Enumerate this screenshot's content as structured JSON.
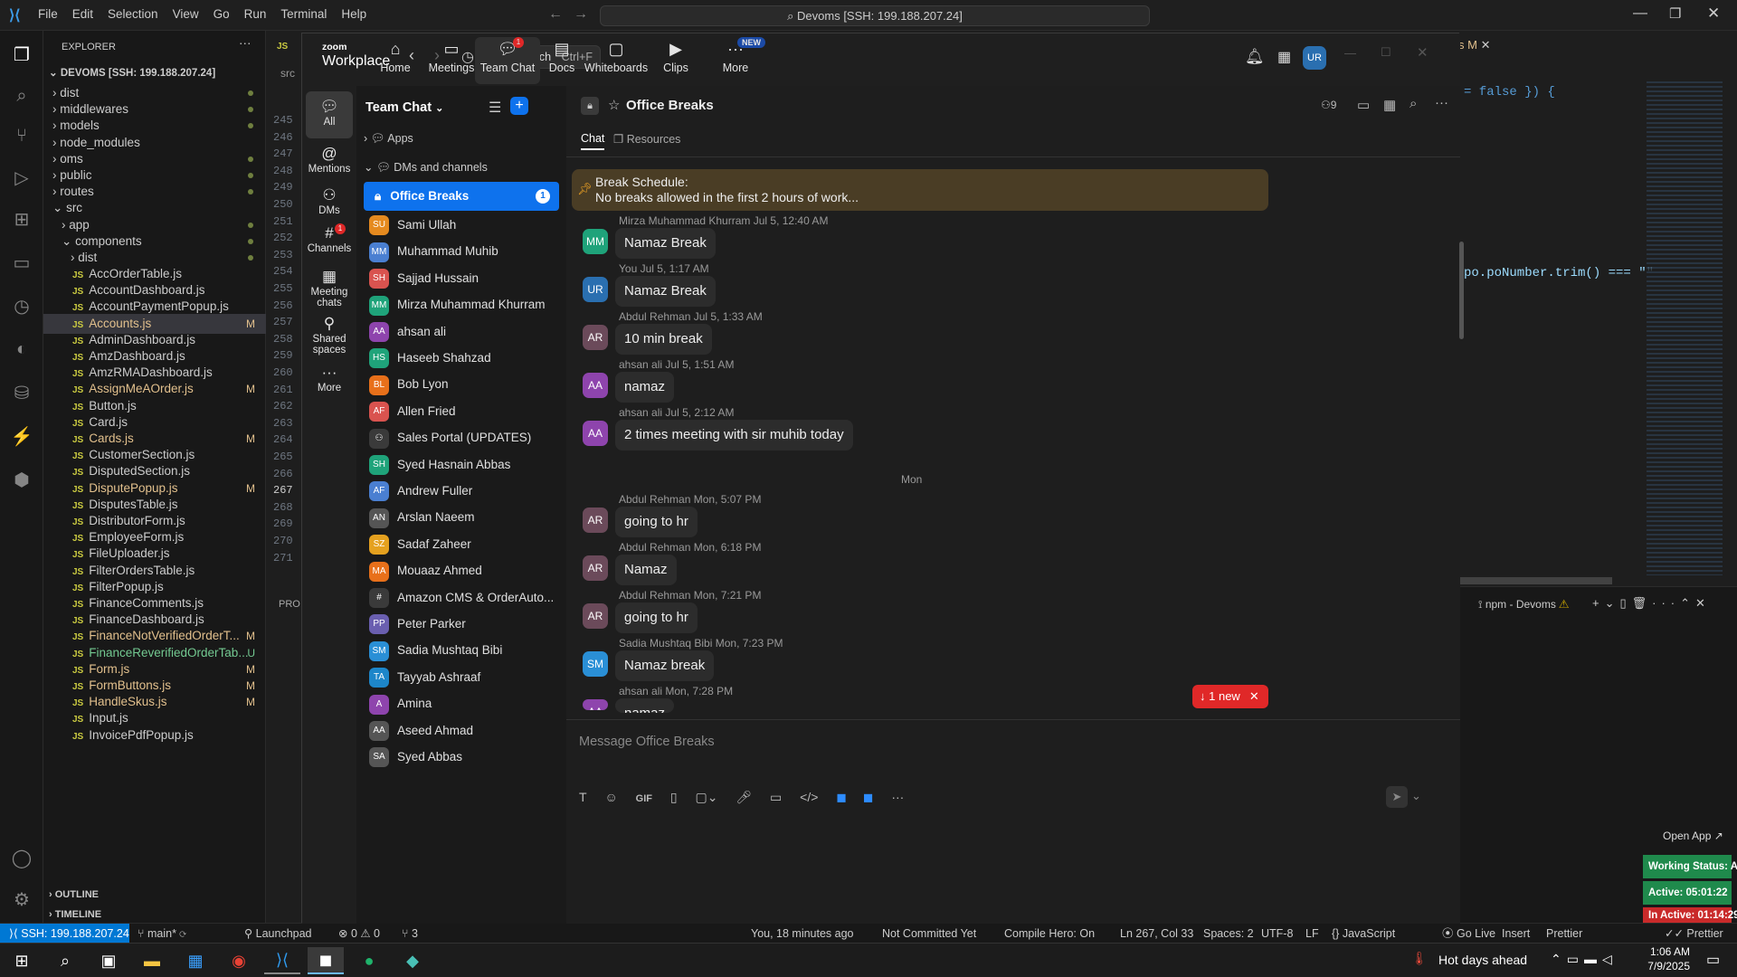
{
  "vscode": {
    "menu": [
      "File",
      "Edit",
      "Selection",
      "View",
      "Go",
      "Run",
      "Terminal",
      "Help"
    ],
    "command_center": "Devoms [SSH: 199.188.207.24]",
    "explorer_title": "EXPLORER",
    "root": "DEVOMS [SSH: 199.188.207.24]",
    "folders": [
      "dist",
      "middlewares",
      "models",
      "node_modules",
      "oms",
      "public",
      "routes",
      "src",
      "app",
      "components",
      "dist"
    ],
    "files": [
      {
        "name": "AccOrderTable.js",
        "git": ""
      },
      {
        "name": "AccountDashboard.js",
        "git": ""
      },
      {
        "name": "AccountPaymentPopup.js",
        "git": ""
      },
      {
        "name": "Accounts.js",
        "git": "M"
      },
      {
        "name": "AdminDashboard.js",
        "git": ""
      },
      {
        "name": "AmzDashboard.js",
        "git": ""
      },
      {
        "name": "AmzRMADashboard.js",
        "git": ""
      },
      {
        "name": "AssignMeAOrder.js",
        "git": "M"
      },
      {
        "name": "Button.js",
        "git": ""
      },
      {
        "name": "Card.js",
        "git": ""
      },
      {
        "name": "Cards.js",
        "git": "M"
      },
      {
        "name": "CustomerSection.js",
        "git": ""
      },
      {
        "name": "DisputedSection.js",
        "git": ""
      },
      {
        "name": "DisputePopup.js",
        "git": "M"
      },
      {
        "name": "DisputesTable.js",
        "git": ""
      },
      {
        "name": "DistributorForm.js",
        "git": ""
      },
      {
        "name": "EmployeeForm.js",
        "git": ""
      },
      {
        "name": "FileUploader.js",
        "git": ""
      },
      {
        "name": "FilterOrdersTable.js",
        "git": ""
      },
      {
        "name": "FilterPopup.js",
        "git": ""
      },
      {
        "name": "FinanceComments.js",
        "git": ""
      },
      {
        "name": "FinanceDashboard.js",
        "git": ""
      },
      {
        "name": "FinanceNotVerifiedOrderT...",
        "git": "M"
      },
      {
        "name": "FinanceReverifiedOrderTab...",
        "git": "U"
      },
      {
        "name": "Form.js",
        "git": "M"
      },
      {
        "name": "FormButtons.js",
        "git": "M"
      },
      {
        "name": "HandleSkus.js",
        "git": "M"
      },
      {
        "name": "Input.js",
        "git": ""
      },
      {
        "name": "InvoicePdfPopup.js",
        "git": ""
      }
    ],
    "outline": "OUTLINE",
    "timeline": "TIMELINE",
    "line_numbers": [
      "245",
      "246",
      "247",
      "248",
      "249",
      "250",
      "251",
      "252",
      "253",
      "254",
      "255",
      "256",
      "257",
      "258",
      "259",
      "260",
      "261",
      "262",
      "263",
      "264",
      "265",
      "266",
      "267",
      "268",
      "269",
      "270",
      "271"
    ],
    "code_line_1": "= false }) {",
    "code_line_2": "po.poNumber.trim() === \"\"",
    "tab_right": "s M",
    "terminal_title": "npm - Devoms",
    "open_app": "Open App ↗",
    "working_status": "Working Status: Active",
    "active_time": "Active: 05:01:22",
    "inactive_time": "In Active: 01:14:29",
    "status": {
      "remote": "SSH: 199.188.207.24",
      "branch": "main*",
      "launchpad": "Launchpad",
      "problems": "⊗ 0 ⚠ 0",
      "ports": "⑂ 3",
      "blame": "You, 18 minutes ago",
      "commit": "Not Committed Yet",
      "compile": "Compile Hero: On",
      "position": "Ln 267, Col 33",
      "spaces": "Spaces: 2",
      "encoding": "UTF-8",
      "eol": "LF",
      "lang": "JavaScript",
      "golive": "Go Live",
      "insert": "Insert",
      "prettier": "Prettier"
    }
  },
  "taskbar": {
    "weather": "Hot days ahead",
    "time": "1:06 AM",
    "date": "7/9/2025"
  },
  "zoom": {
    "brand_top": "zoom",
    "brand": "Workplace",
    "search": "Search",
    "search_kbd": "Ctrl+F",
    "tabs": [
      {
        "label": "Home",
        "icon": "home-icon"
      },
      {
        "label": "Meetings",
        "icon": "video-icon"
      },
      {
        "label": "Team Chat",
        "icon": "chat-icon",
        "badge": "1"
      },
      {
        "label": "Docs",
        "icon": "docs-icon"
      },
      {
        "label": "Whiteboards",
        "icon": "whiteboard-icon"
      },
      {
        "label": "Clips",
        "icon": "clips-icon"
      },
      {
        "label": "More",
        "icon": "more-icon",
        "badge": "NEW"
      }
    ],
    "avatar": "UR",
    "rail": [
      {
        "label": "All"
      },
      {
        "label": "Mentions"
      },
      {
        "label": "DMs"
      },
      {
        "label": "Channels",
        "badge": "1"
      },
      {
        "label": "Meeting chats"
      },
      {
        "label": "Shared spaces"
      },
      {
        "label": "More"
      }
    ],
    "list_title": "Team Chat",
    "apps": "Apps",
    "dms_channels": "DMs and channels",
    "selected": {
      "name": "Office Breaks",
      "badge": "1"
    },
    "contacts": [
      {
        "name": "Sami Ullah",
        "init": "SU",
        "color": "#e58a1f",
        "online": true
      },
      {
        "name": "Muhammad Muhib",
        "init": "MM",
        "color": "#4a7fd1",
        "online": false
      },
      {
        "name": "Sajjad Hussain",
        "init": "SH",
        "color": "#d9534f",
        "online": true
      },
      {
        "name": "Mirza Muhammad Khurram",
        "init": "MM",
        "color": "#1fa37a",
        "online": true
      },
      {
        "name": "ahsan ali",
        "init": "AA",
        "color": "#8e44ad",
        "online": false
      },
      {
        "name": "Haseeb Shahzad",
        "init": "HS",
        "color": "#1fa37a",
        "online": true
      },
      {
        "name": "Bob Lyon",
        "init": "BL",
        "color": "#e8701a",
        "online": false
      },
      {
        "name": "Allen Fried",
        "init": "AF",
        "color": "#d9534f",
        "online": true
      },
      {
        "name": "Sales Portal (UPDATES)",
        "init": "",
        "color": "#3a3a3a",
        "online": false
      },
      {
        "name": "Syed Hasnain Abbas",
        "init": "SH",
        "color": "#1fa37a",
        "online": true
      },
      {
        "name": "Andrew Fuller",
        "init": "AF",
        "color": "#4a7fd1",
        "online": false
      },
      {
        "name": "Arslan Naeem",
        "init": "AN",
        "color": "#555",
        "online": true
      },
      {
        "name": "Sadaf Zaheer",
        "init": "SZ",
        "color": "#e5a11f",
        "online": false
      },
      {
        "name": "Mouaaz Ahmed",
        "init": "MA",
        "color": "#e8701a",
        "online": false
      },
      {
        "name": "Amazon CMS & OrderAuto...",
        "init": "#",
        "color": "#3a3a3a",
        "online": false
      },
      {
        "name": "Peter Parker",
        "init": "PP",
        "color": "#6a5fb0",
        "online": false
      },
      {
        "name": "Sadia Mushtaq Bibi",
        "init": "SM",
        "color": "#2a8fd6",
        "online": true
      },
      {
        "name": "Tayyab Ashraaf",
        "init": "TA",
        "color": "#1d86c9",
        "online": false
      },
      {
        "name": "Amina",
        "init": "A",
        "color": "#8e44ad",
        "online": false
      },
      {
        "name": "Aseed Ahmad",
        "init": "AA",
        "color": "#555",
        "online": true
      },
      {
        "name": "Syed Abbas",
        "init": "SA",
        "color": "#555",
        "online": true
      }
    ],
    "channel_title": "Office Breaks",
    "member_count": "9",
    "subtabs": [
      "Chat",
      "Resources"
    ],
    "pinned": {
      "title": "Break Schedule:",
      "text": "No breaks allowed in the first 2 hours of work..."
    },
    "date_divider": "Mon",
    "messages": [
      {
        "sender": "Mirza Muhammad Khurram",
        "time": "Jul 5, 12:40 AM",
        "text": "Namaz Break",
        "init": "MM",
        "color": "#1fa37a"
      },
      {
        "sender": "You",
        "time": "Jul 5, 1:17 AM",
        "text": "Namaz Break",
        "init": "UR",
        "color": "#2a6fb0"
      },
      {
        "sender": "Abdul Rehman",
        "time": "Jul 5, 1:33 AM",
        "text": "10 min break",
        "init": "AR",
        "color": "#6b4a5a"
      },
      {
        "sender": "ahsan ali",
        "time": "Jul 5, 1:51 AM",
        "text": "namaz",
        "init": "AA",
        "color": "#8e44ad"
      },
      {
        "sender": "ahsan ali",
        "time": "Jul 5, 2:12 AM",
        "text": "2 times meeting with sir muhib today",
        "init": "AA",
        "color": "#8e44ad"
      },
      {
        "sender": "Abdul Rehman",
        "time": "Mon, 5:07 PM",
        "text": "going to hr",
        "init": "AR",
        "color": "#6b4a5a"
      },
      {
        "sender": "Abdul Rehman",
        "time": "Mon, 6:18 PM",
        "text": "Namaz",
        "init": "AR",
        "color": "#6b4a5a"
      },
      {
        "sender": "Abdul Rehman",
        "time": "Mon, 7:21 PM",
        "text": "going to hr",
        "init": "AR",
        "color": "#6b4a5a"
      },
      {
        "sender": "Sadia Mushtaq Bibi",
        "time": "Mon, 7:23 PM",
        "text": "Namaz break",
        "init": "SM",
        "color": "#2a8fd6"
      },
      {
        "sender": "ahsan ali",
        "time": "Mon, 7:28 PM",
        "text": "namaz",
        "init": "AA",
        "color": "#8e44ad"
      }
    ],
    "new_pill": "1 new",
    "composer_placeholder": "Message Office Breaks"
  }
}
